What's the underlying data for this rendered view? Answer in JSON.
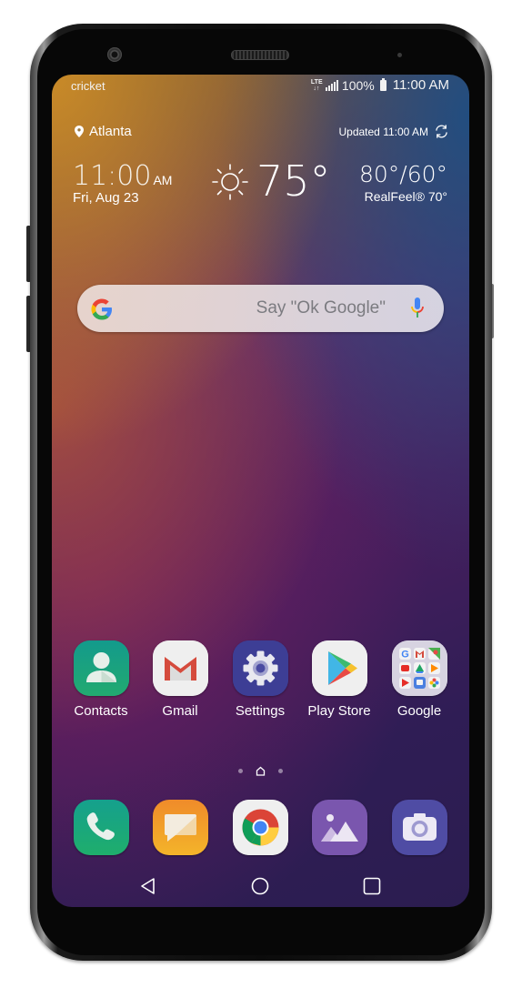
{
  "status_bar": {
    "carrier": "cricket",
    "network_type": "LTE",
    "battery_percent": "100%",
    "time": "11:00 AM",
    "icons": [
      "lte-icon",
      "signal-icon",
      "battery-icon"
    ]
  },
  "weather_widget": {
    "location": "Atlanta",
    "updated": "Updated 11:00 AM",
    "clock_time": "11:00",
    "clock_ampm": "AM",
    "date": "Fri, Aug 23",
    "condition_icon": "sun-icon",
    "current_temp": "75°",
    "high_low": "80°/60°",
    "realfeel": "RealFeel® 70°"
  },
  "search_bar": {
    "placeholder": "Say \"Ok Google\"",
    "left_icon": "google-logo-icon",
    "right_icon": "microphone-icon"
  },
  "home_apps": [
    {
      "label": "Contacts",
      "icon": "contacts-icon",
      "color": "#1aa37f"
    },
    {
      "label": "Gmail",
      "icon": "gmail-icon",
      "color": "#eeeeee"
    },
    {
      "label": "Settings",
      "icon": "settings-icon",
      "color": "#3f3f98"
    },
    {
      "label": "Play Store",
      "icon": "play-store-icon",
      "color": "#eeeeee"
    },
    {
      "label": "Google",
      "icon": "google-folder-icon",
      "color": "#d8d4e2"
    }
  ],
  "google_folder_apps": [
    "Google",
    "Gmail",
    "Maps",
    "YouTube",
    "Drive",
    "Play Music",
    "Play Movies",
    "Duo",
    "Photos"
  ],
  "page_indicator": {
    "pages": 3,
    "current": "home"
  },
  "dock_apps": [
    {
      "name": "Phone",
      "icon": "phone-icon",
      "color": "#15a785"
    },
    {
      "name": "Messages",
      "icon": "messages-icon",
      "color": "#f1a12a"
    },
    {
      "name": "Chrome",
      "icon": "chrome-icon",
      "color": "#eeeeee"
    },
    {
      "name": "Gallery",
      "icon": "gallery-icon",
      "color": "#7a55b0"
    },
    {
      "name": "Camera",
      "icon": "camera-icon",
      "color": "#4e4aa2"
    }
  ],
  "nav_bar": {
    "back": "back-icon",
    "home": "home-icon",
    "recents": "recents-icon"
  }
}
